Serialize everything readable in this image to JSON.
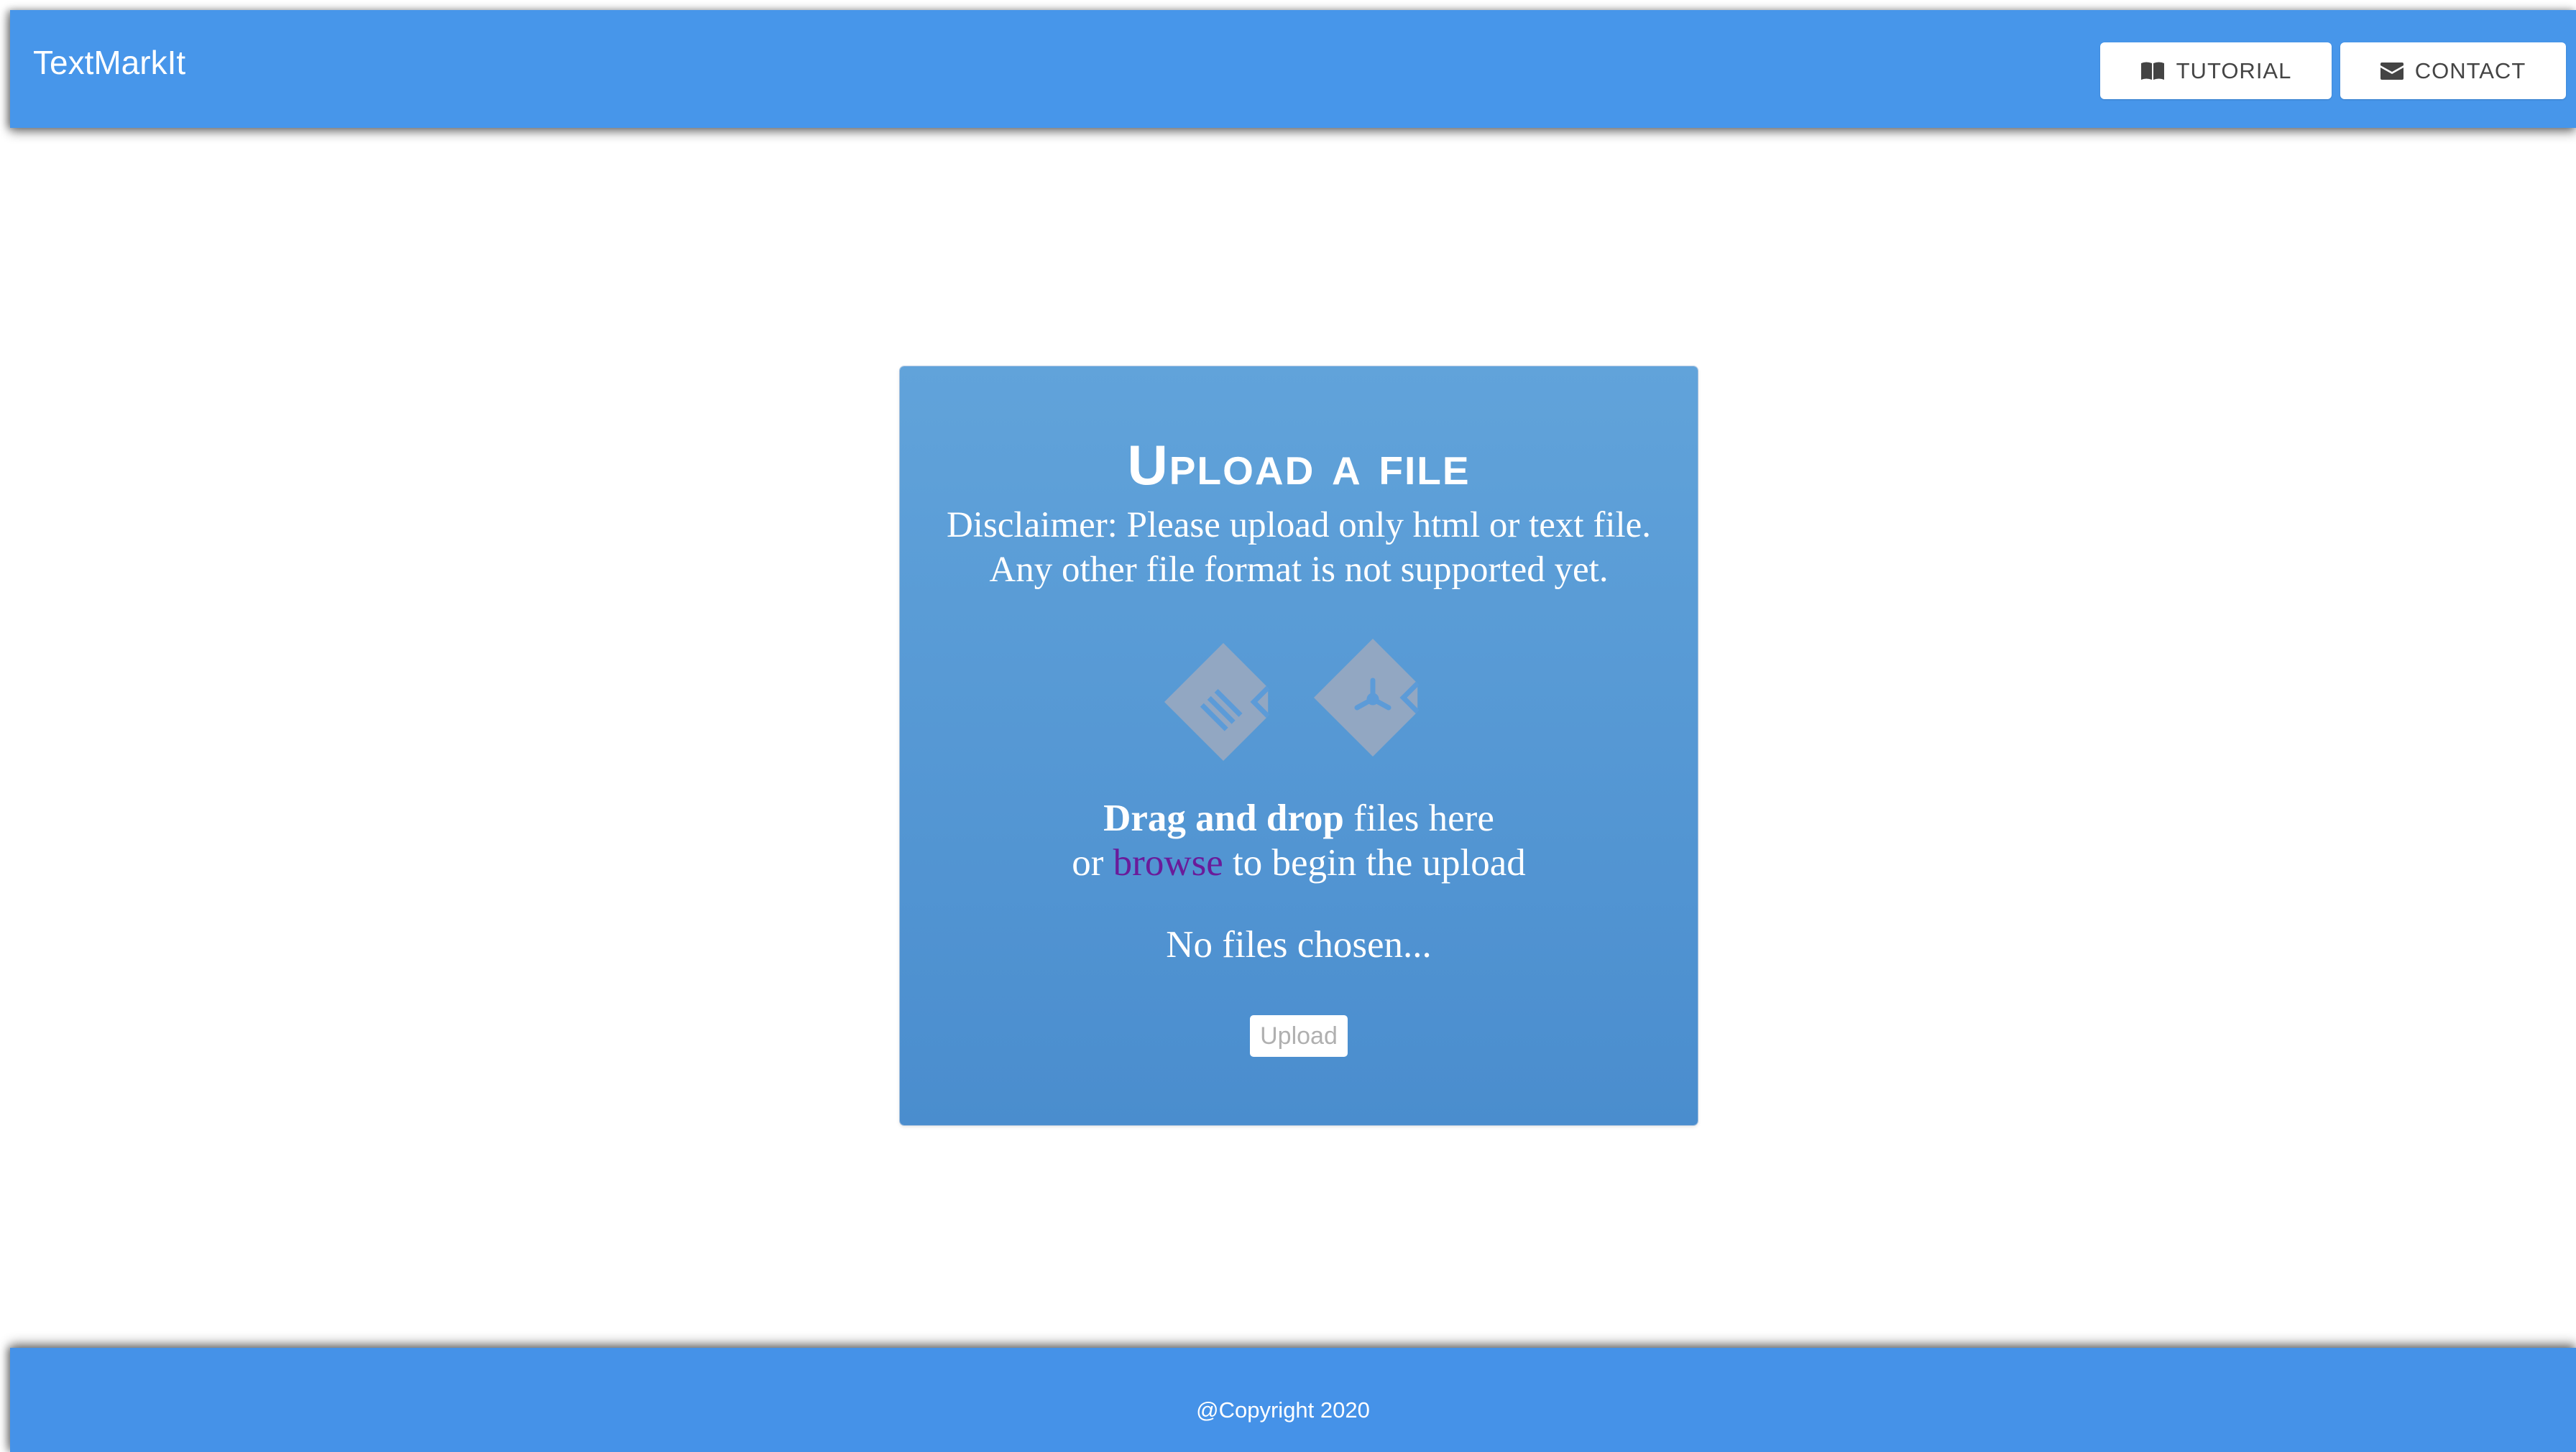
{
  "header": {
    "brand": "TextMarkIt",
    "nav": [
      {
        "label": "TUTORIAL",
        "icon": "book-icon"
      },
      {
        "label": "CONTACT",
        "icon": "envelope-icon"
      }
    ]
  },
  "upload": {
    "title": "Upload a file",
    "disclaimer_line1": "Disclaimer: Please upload only html or text file.",
    "disclaimer_line2": "Any other file format is not supported yet.",
    "file_icons": [
      "document-file-icon",
      "pdf-file-icon"
    ],
    "drag_bold": "Drag and drop",
    "drag_rest": " files here",
    "or_text": "or ",
    "browse_label": "browse",
    "after_browse": " to begin the upload",
    "status": "No files chosen...",
    "upload_button": "Upload"
  },
  "footer": {
    "copyright": "@Copyright 2020"
  },
  "colors": {
    "header_bg": "#4796ea",
    "card_top": "#61a3da",
    "card_bottom": "#4a8dce",
    "browse_link": "#6a1b9a",
    "footer_bg": "#4592e8"
  }
}
